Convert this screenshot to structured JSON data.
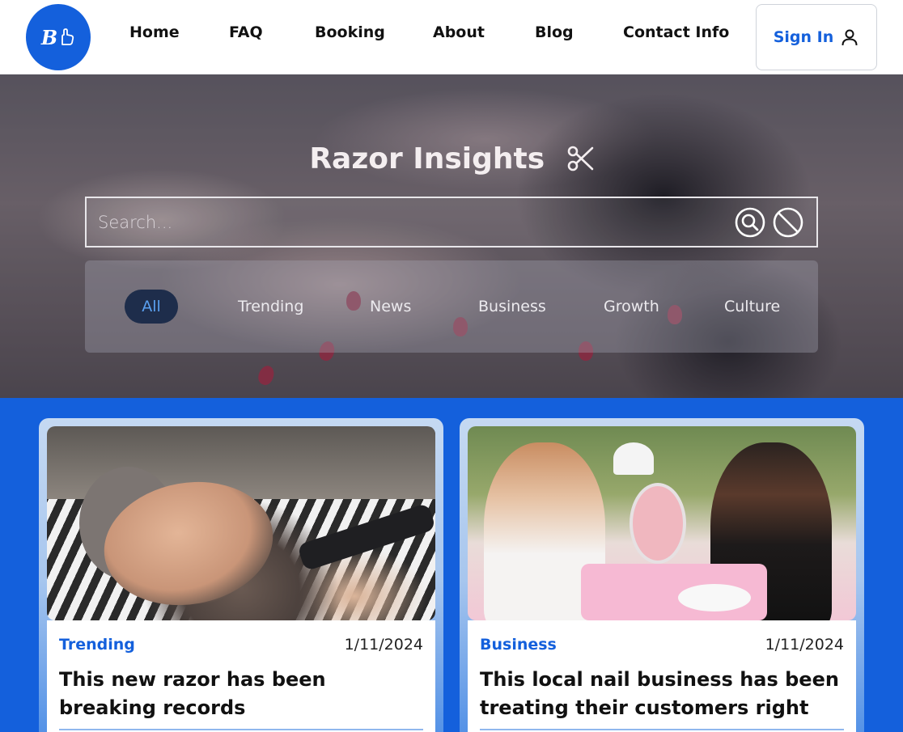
{
  "brand": {
    "logo_text": "B"
  },
  "nav": {
    "links": [
      "Home",
      "FAQ",
      "Booking",
      "About",
      "Blog",
      "Contact Info"
    ],
    "sign_in": "Sign In"
  },
  "hero": {
    "title": "Razor Insights",
    "search_placeholder": "Search...",
    "filters": [
      "All",
      "Trending",
      "News",
      "Business",
      "Growth",
      "Culture"
    ],
    "active_filter": "All"
  },
  "posts": [
    {
      "category": "Trending",
      "date": "1/11/2024",
      "title": "This new razor has been breaking records"
    },
    {
      "category": "Business",
      "date": "1/11/2024",
      "title": "This local nail business has been treating their customers right"
    }
  ],
  "colors": {
    "brand": "#1460dc",
    "active_pill": "#1e2d4b",
    "active_text": "#5aa0f0"
  },
  "icons": {
    "sign_in": "user-icon",
    "title": "scissors-icon",
    "search": "search-icon",
    "clear": "clear-icon"
  }
}
